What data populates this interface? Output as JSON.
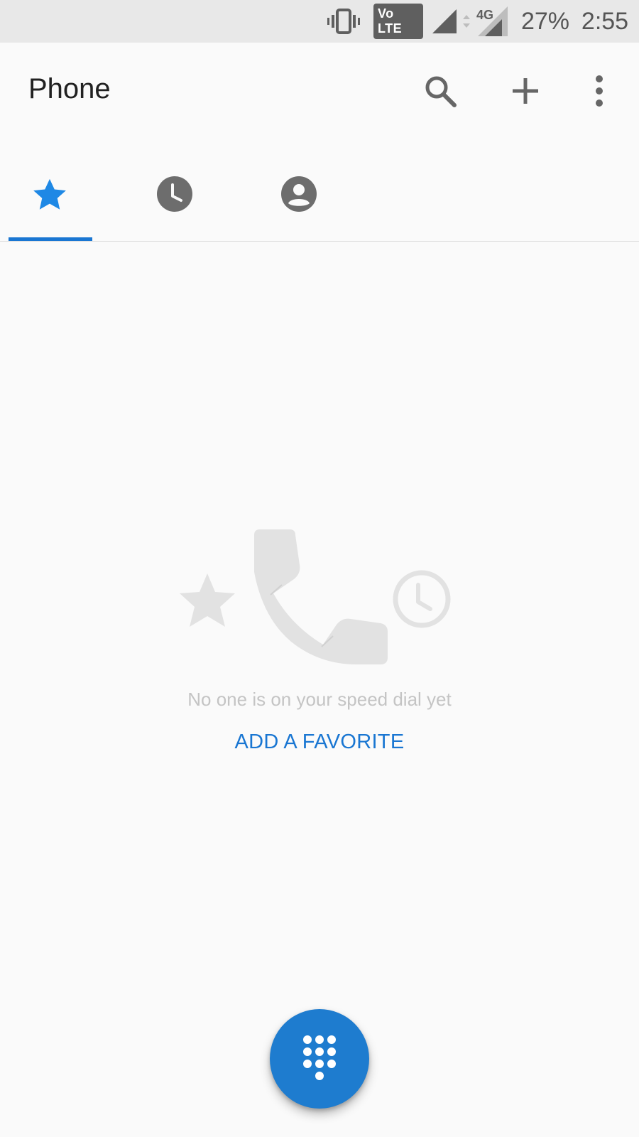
{
  "status_bar": {
    "vibrate_icon": "vibrate-icon",
    "volte_label": "Vo LTE",
    "signal_icon": "signal-icon",
    "network_label": "4G",
    "battery": "27%",
    "time": "2:55"
  },
  "app_bar": {
    "title": "Phone",
    "actions": [
      "search-icon",
      "add-icon",
      "more-vert-icon"
    ]
  },
  "tabs": [
    {
      "icon": "star-icon",
      "selected": true
    },
    {
      "icon": "clock-icon",
      "selected": false
    },
    {
      "icon": "person-icon",
      "selected": false
    }
  ],
  "empty_state": {
    "message": "No one is on your speed dial yet",
    "action_label": "ADD A FAVORITE",
    "illustration_icons": [
      "star-icon",
      "phone-icon",
      "clock-icon"
    ]
  },
  "fab": {
    "icon": "dialpad-icon"
  },
  "colors": {
    "accent": "#1976d2",
    "fab": "#1e7ccf",
    "icon_gray": "#666666",
    "empty_gray": "#e0e0e0"
  }
}
